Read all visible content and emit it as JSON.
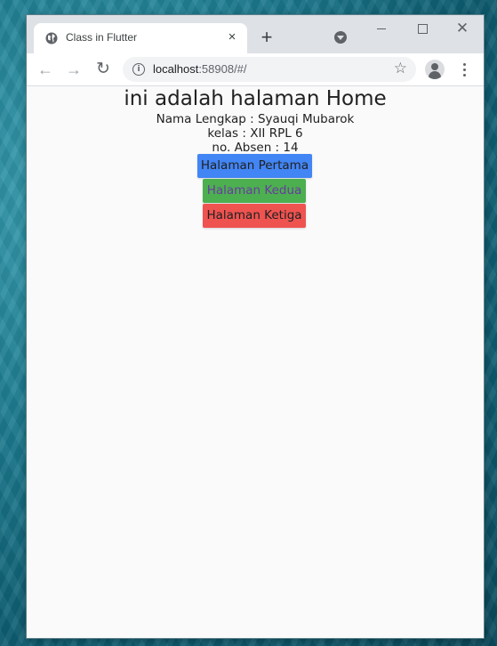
{
  "browser": {
    "tab_title": "Class in Flutter",
    "tab_close": "×",
    "new_tab": "+",
    "window_close": "✕",
    "url_host": "localhost",
    "url_rest": ":58908/#/"
  },
  "page": {
    "heading": "ini adalah halaman Home",
    "name_line": "Nama Lengkap : Syauqi Mubarok",
    "class_line": "kelas : XII RPL 6",
    "absen_line": "no. Absen : 14",
    "buttons": [
      {
        "label": "Halaman Pertama",
        "color": "#4285f4"
      },
      {
        "label": "Halaman Kedua",
        "color": "#4caf50"
      },
      {
        "label": "Halaman Ketiga",
        "color": "#ef5350"
      }
    ]
  },
  "icons": [
    "globe-icon",
    "close-icon",
    "plus-icon",
    "tab-search-icon",
    "back-icon",
    "forward-icon",
    "reload-icon",
    "info-icon",
    "star-icon",
    "profile-icon",
    "menu-icon",
    "minimize-icon",
    "maximize-icon"
  ]
}
